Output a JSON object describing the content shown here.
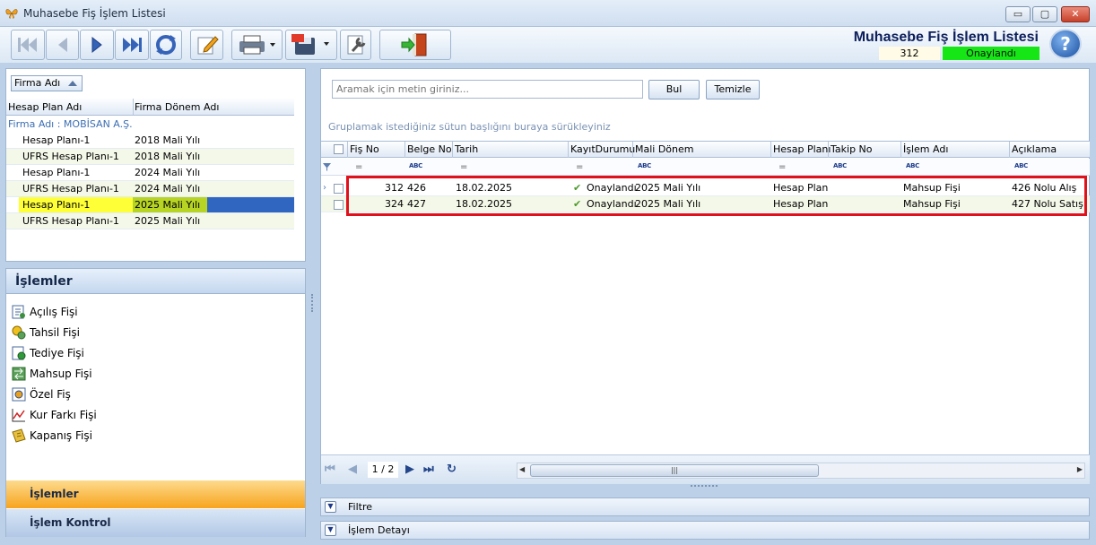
{
  "window": {
    "title": "Muhasebe Fiş İşlem Listesi",
    "minimize": "▭",
    "maximize": "▢",
    "close": "✕"
  },
  "header": {
    "report_title": "Muhasebe Fiş İşlem Listesi",
    "fis_no": "312",
    "status": "Onaylandı",
    "help": "?"
  },
  "left_top": {
    "group_chip": "Firma Adı",
    "columns": [
      "Hesap Plan Adı",
      "Firma Dönem Adı"
    ],
    "group_row": "Firma Adı : MOBİSAN A.Ş.",
    "rows": [
      {
        "plan": "Hesap Planı-1",
        "donem": "2018 Mali Yılı"
      },
      {
        "plan": "UFRS Hesap Planı-1",
        "donem": "2018 Mali Yılı"
      },
      {
        "plan": "Hesap Planı-1",
        "donem": "2024 Mali Yılı"
      },
      {
        "plan": "UFRS Hesap Planı-1",
        "donem": "2024 Mali Yılı"
      },
      {
        "plan": "Hesap Planı-1",
        "donem": "2025 Mali Yılı"
      },
      {
        "plan": "UFRS Hesap Planı-1",
        "donem": "2025 Mali Yılı"
      }
    ]
  },
  "islemler": {
    "title": "İşlemler",
    "items": [
      "Açılış Fişi",
      "Tahsil Fişi",
      "Tediye Fişi",
      "Mahsup Fişi",
      "Özel Fiş",
      "Kur Farkı Fişi",
      "Kapanış Fişi"
    ],
    "nav": [
      "İşlemler",
      "İşlem Kontrol"
    ]
  },
  "search": {
    "placeholder": "Aramak için metin giriniz...",
    "find": "Bul",
    "clear": "Temizle"
  },
  "grid": {
    "group_hint": "Gruplamak istediğiniz sütun başlığını buraya sürükleyiniz",
    "columns": [
      "Fiş No",
      "Belge No",
      "Tarih",
      "KayıtDurumu",
      "Mali Dönem",
      "Hesap Planı",
      "Takip No",
      "İşlem Adı",
      "Açıklama"
    ],
    "filter_ops": [
      "=",
      "ABC",
      "=",
      "=",
      "ABC",
      "=",
      "ABC",
      "ABC",
      "ABC"
    ],
    "rows": [
      {
        "fis_no": "312",
        "belge_no": "426",
        "tarih": "18.02.2025",
        "durum": "Onaylandı",
        "donem": "2025 Mali Yılı",
        "plan": "Hesap Planı-",
        "takip": "",
        "islem": "Mahsup Fişi",
        "aciklama": "426 Nolu Alış"
      },
      {
        "fis_no": "324",
        "belge_no": "427",
        "tarih": "18.02.2025",
        "durum": "Onaylandı",
        "donem": "2025 Mali Yılı",
        "plan": "Hesap Planı-",
        "takip": "",
        "islem": "Mahsup Fişi",
        "aciklama": "427 Nolu Satış"
      }
    ],
    "page": "1 / 2",
    "scroll_glyph": "|||"
  },
  "bottom": {
    "filter": "Filtre",
    "detail": "İşlem Detayı"
  },
  "colors": {
    "status_green": "#16e616",
    "highlight_red": "#e0111b",
    "nav_active": "#f7a41d"
  }
}
